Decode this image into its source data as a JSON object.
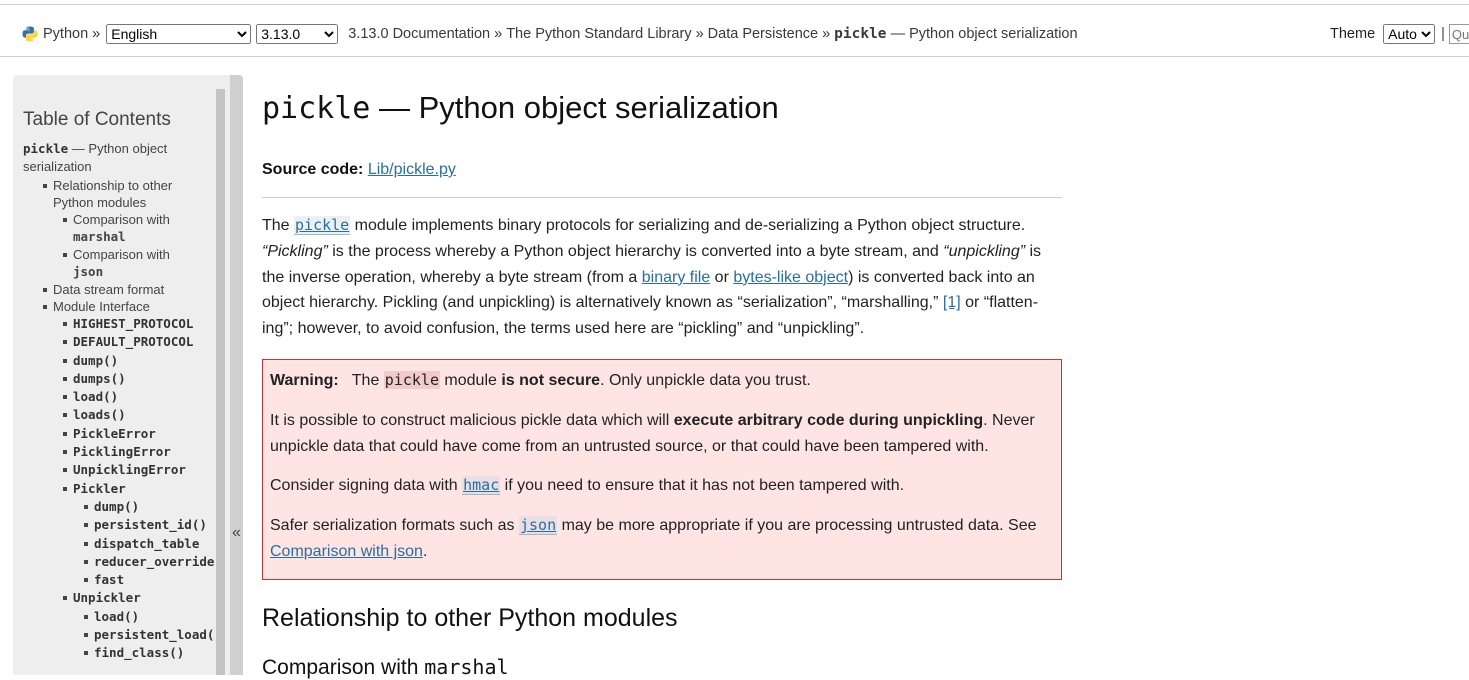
{
  "nav": {
    "home": "Python",
    "sep": "»",
    "language": "English",
    "language_options": [
      "English"
    ],
    "version": "3.13.0",
    "version_options": [
      "3.13.0"
    ],
    "crumbs": [
      "3.13.0 Documentation",
      "The Python Standard Library",
      "Data Persistence"
    ],
    "current_code": "pickle",
    "current_text": "— Python object serialization"
  },
  "theme": {
    "label": "Theme",
    "value": "Auto",
    "options": [
      "Auto"
    ],
    "pipe": "|",
    "search_placeholder": "Quick search"
  },
  "sidebar": {
    "title": "Table of Contents",
    "root_code": "pickle",
    "root_text": "— Python object serialization",
    "rel": "Relationship to other Python modules",
    "cmp_prefix": "Comparison with",
    "cmp_marshal": "marshal",
    "cmp_json": "json",
    "stream": "Data stream format",
    "iface": "Module Interface",
    "iface_items": [
      "HIGHEST_PROTOCOL",
      "DEFAULT_PROTOCOL",
      "dump()",
      "dumps()",
      "load()",
      "loads()",
      "PickleError",
      "PicklingError",
      "UnpicklingError"
    ],
    "pickler": "Pickler",
    "pickler_items": [
      "dump()",
      "persistent_id()",
      "dispatch_table",
      "reducer_override",
      "fast"
    ],
    "unpickler": "Unpickler",
    "unpickler_items": [
      "load()",
      "persistent_load(",
      "find_class()"
    ],
    "collapse": "«"
  },
  "main": {
    "title_code": "pickle",
    "title_text": " — Python object serialization",
    "source_label": "Source code:",
    "source_link": "Lib/pickle.py",
    "intro": {
      "t1": "The ",
      "code": "pickle",
      "t2": " module implements binary protocols for serializing and de-serializing a Python object structure. ",
      "pickling": "“Pickling”",
      "t3": " is the process whereby a Python object hierarchy is converted into a byte stream, and ",
      "unpickling": "“unpickling”",
      "t4": " is the inverse operation, whereby a byte stream (from a ",
      "link1": "binary file",
      "t5": " or ",
      "link2": "bytes-like object",
      "t6": ") is converted back into an object hierarchy. Pickling (and unpickling) is alternatively known as “serialization”, “marshalling,” ",
      "fn": "[1]",
      "t7": " or “flatten-ing”; however, to avoid confusion, the terms used here are “pickling” and “unpickling”."
    },
    "warning": {
      "label": "Warning:",
      "w1": "The ",
      "code": "pickle",
      "w2": " module ",
      "bold": "is not secure",
      "w3": ". Only unpickle data you trust.",
      "p2a": "It is possible to construct malicious pickle data which will ",
      "p2b": "execute arbitrary code during unpickling",
      "p2c": ". Never unpickle data that could have come from an untrusted source, or that could have been tampered with.",
      "p3a": "Consider signing data with ",
      "p3code": "hmac",
      "p3b": " if you need to ensure that it has not been tampered with.",
      "p4a": "Safer serialization formats such as ",
      "p4code": "json",
      "p4b": " may be more appropriate if you are processing untrusted data. See ",
      "p4link": "Comparison with json",
      "p4c": "."
    },
    "h2": "Relationship to other Python modules",
    "h3_text": "Comparison with ",
    "h3_code": "marshal"
  }
}
